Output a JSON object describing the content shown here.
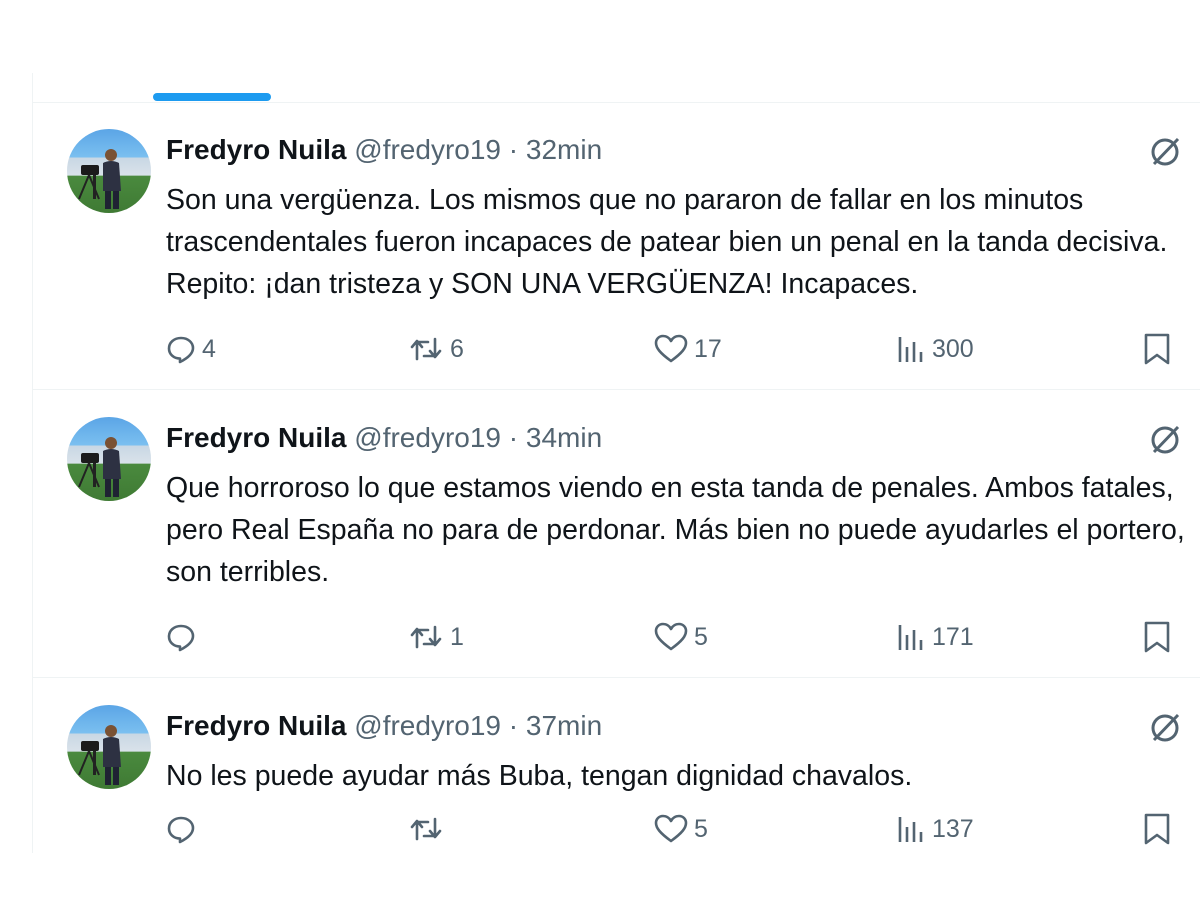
{
  "tweets": [
    {
      "name": "Fredyro Nuila",
      "handle": "@fredyro19",
      "separator": "·",
      "time": "32min",
      "text": "Son una vergüenza. Los mismos que no pararon de fallar en los minutos trascendentales fueron incapaces de patear bien un penal en la tanda decisiva. Repito: ¡dan tristeza y SON UNA VERGÜENZA! Incapaces.",
      "replies": "4",
      "reposts": "6",
      "likes": "17",
      "views": "300"
    },
    {
      "name": "Fredyro Nuila",
      "handle": "@fredyro19",
      "separator": "·",
      "time": "34min",
      "text": "Que horroroso lo que estamos viendo en esta tanda de penales. Ambos fatales, pero Real España no para de perdonar. Más bien no puede ayudarles el portero, son terribles.",
      "replies": "",
      "reposts": "1",
      "likes": "5",
      "views": "171"
    },
    {
      "name": "Fredyro Nuila",
      "handle": "@fredyro19",
      "separator": "·",
      "time": "37min",
      "text": "No les puede ayudar más Buba, tengan dignidad chavalos.",
      "replies": "",
      "reposts": "",
      "likes": "5",
      "views": "137"
    }
  ],
  "colors": {
    "accent": "#1d9bf0",
    "text": "#0f1419",
    "secondary": "#536471",
    "divider": "#eff3f4"
  },
  "icons": [
    "reply-icon",
    "repost-icon",
    "like-icon",
    "views-icon",
    "bookmark-icon",
    "grok-icon"
  ]
}
